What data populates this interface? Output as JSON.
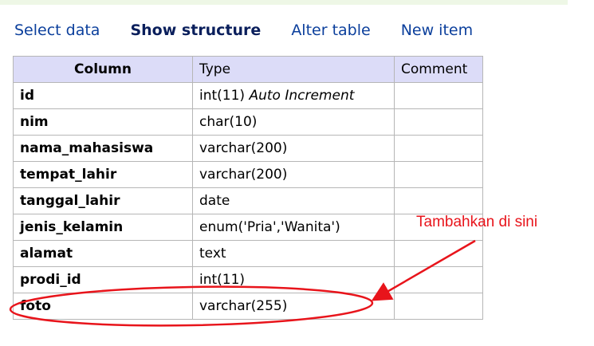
{
  "nav": {
    "items": [
      {
        "label": "Select data",
        "active": false
      },
      {
        "label": "Show structure",
        "active": true
      },
      {
        "label": "Alter table",
        "active": false
      },
      {
        "label": "New item",
        "active": false
      }
    ]
  },
  "table": {
    "headers": [
      "Column",
      "Type",
      "Comment"
    ],
    "rows": [
      {
        "column": "id",
        "type": "int(11)",
        "extra": "Auto Increment",
        "comment": ""
      },
      {
        "column": "nim",
        "type": "char(10)",
        "extra": "",
        "comment": ""
      },
      {
        "column": "nama_mahasiswa",
        "type": "varchar(200)",
        "extra": "",
        "comment": ""
      },
      {
        "column": "tempat_lahir",
        "type": "varchar(200)",
        "extra": "",
        "comment": ""
      },
      {
        "column": "tanggal_lahir",
        "type": "date",
        "extra": "",
        "comment": ""
      },
      {
        "column": "jenis_kelamin",
        "type": "enum('Pria','Wanita')",
        "extra": "",
        "comment": ""
      },
      {
        "column": "alamat",
        "type": "text",
        "extra": "",
        "comment": ""
      },
      {
        "column": "prodi_id",
        "type": "int(11)",
        "extra": "",
        "comment": ""
      },
      {
        "column": "foto",
        "type": "varchar(255)",
        "extra": "",
        "comment": ""
      }
    ]
  },
  "annotation": {
    "text": "Tambahkan di sini",
    "color": "#e8141b"
  },
  "colors": {
    "link": "#0b3f9c",
    "header_bg": "#dcdcf8",
    "border": "#b6b6b6",
    "topbar": "#eef7e6"
  }
}
